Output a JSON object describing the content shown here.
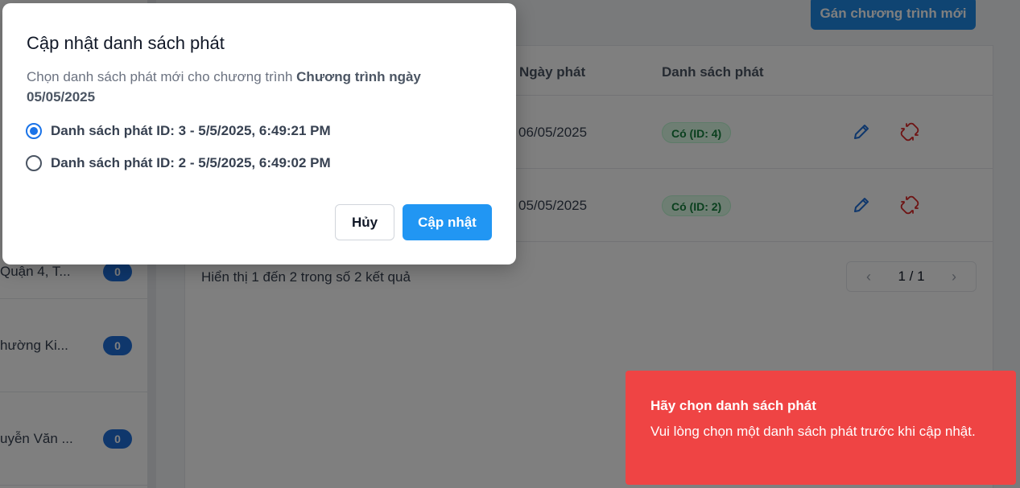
{
  "header": {
    "assign_button": "Gán chương trình mới"
  },
  "sidebar": {
    "items": [
      {
        "label": "Quận 4, T...",
        "count": "0"
      },
      {
        "label": "hường Ki...",
        "count": "0"
      },
      {
        "label": "uyễn Văn ...",
        "count": "0"
      }
    ]
  },
  "table": {
    "columns": {
      "date": "Ngày phát",
      "playlist": "Danh sách phát"
    },
    "rows": [
      {
        "date": "06/05/2025",
        "playlist": "Có (ID: 4)"
      },
      {
        "date": "05/05/2025",
        "playlist": "Có (ID: 2)"
      }
    ],
    "footer": "Hiển thị 1 đến 2 trong số 2 kết quả",
    "pagination": {
      "page": "1 / 1",
      "prev": "‹",
      "next": "›"
    }
  },
  "modal": {
    "title": "Cập nhật danh sách phát",
    "desc_prefix": "Chọn danh sách phát mới cho chương trình ",
    "desc_program": "Chương trình ngày 05/05/2025",
    "options": [
      {
        "label": "Danh sách phát ID: 3 - 5/5/2025, 6:49:21 PM",
        "checked": true
      },
      {
        "label": "Danh sách phát ID: 2 - 5/5/2025, 6:49:02 PM",
        "checked": false
      }
    ],
    "cancel_label": "Hủy",
    "update_label": "Cập nhật"
  },
  "toast": {
    "title": "Hãy chọn danh sách phát",
    "message": "Vui lòng chọn một danh sách phát trước khi cập nhật."
  },
  "colors": {
    "primary": "#2196f3",
    "toast_error": "#ef4444",
    "badge": "#1e6fd9",
    "pill_bg": "#dcfce7",
    "pill_text": "#15803d"
  },
  "icons": {
    "edit": "pencil-icon",
    "unlink": "unlink-icon",
    "prev": "chevron-left-icon",
    "next": "chevron-right-icon"
  }
}
